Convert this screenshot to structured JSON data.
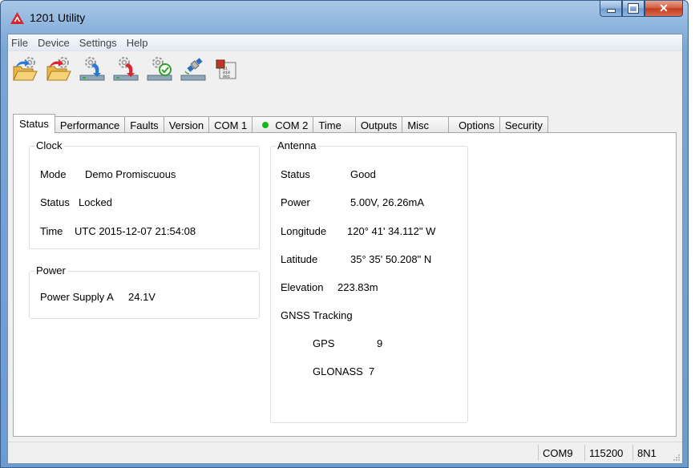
{
  "window": {
    "title": "1201 Utility"
  },
  "menu": [
    "File",
    "Device",
    "Settings",
    "Help"
  ],
  "toolbar": [
    {
      "icon": "open-config-icon"
    },
    {
      "icon": "save-config-icon"
    },
    {
      "icon": "device-read-icon"
    },
    {
      "icon": "device-write-icon"
    },
    {
      "icon": "device-verify-icon"
    },
    {
      "icon": "satellite-icon"
    },
    {
      "icon": "firmware-upload-icon"
    }
  ],
  "tabs": [
    {
      "label": "Status",
      "active": true
    },
    {
      "label": "Performance"
    },
    {
      "label": "Faults"
    },
    {
      "label": "Version"
    },
    {
      "label": "COM 1"
    },
    {
      "label": "COM 2",
      "indicator": "#18b418"
    },
    {
      "label": "Time"
    },
    {
      "label": "Outputs"
    },
    {
      "label": "Misc"
    },
    {
      "label": "Options"
    },
    {
      "label": "Security"
    }
  ],
  "clock": {
    "title": "Clock",
    "mode_label": "Mode",
    "mode_value": "Demo Promiscuous",
    "status_label": "Status",
    "status_value": "Locked",
    "time_label": "Time",
    "time_value": "UTC 2015-12-07 21:54:08"
  },
  "power": {
    "title": "Power",
    "supply_label": "Power Supply A",
    "supply_value": "24.1V"
  },
  "antenna": {
    "title": "Antenna",
    "status_label": "Status",
    "status_value": "Good",
    "power_label": "Power",
    "power_value": "5.00V, 26.26mA",
    "longitude_label": "Longitude",
    "longitude_value": "120° 41' 34.112\" W",
    "latitude_label": "Latitude",
    "latitude_value": "35° 35' 50.208\" N",
    "elevation_label": "Elevation",
    "elevation_value": "223.83m",
    "gnss_label": "GNSS Tracking",
    "gps_label": "GPS",
    "gps_value": "9",
    "glonass_label": "GLONASS",
    "glonass_value": "7"
  },
  "statusbar": {
    "port": "COM9",
    "baud": "115200",
    "format": "8N1"
  },
  "colors": {
    "accent_red": "#d8262c",
    "indicator_green": "#18b418",
    "title_bar": "#8fb6de"
  }
}
